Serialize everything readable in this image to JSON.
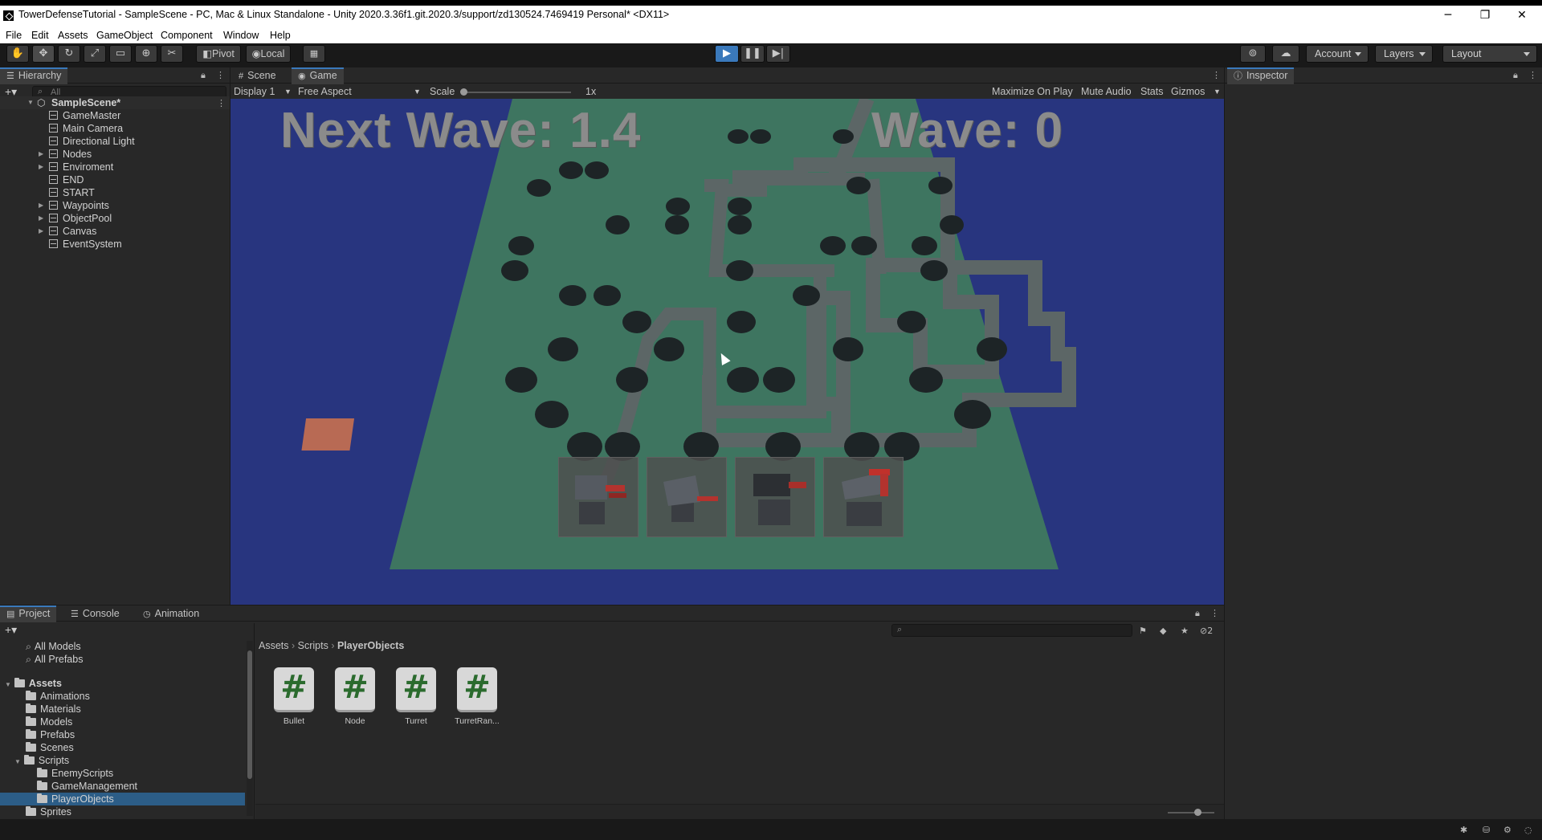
{
  "window": {
    "title": "TowerDefenseTutorial - SampleScene - PC, Mac & Linux Standalone - Unity 2020.3.36f1.git.2020.3/support/zd130524.7469419 Personal* <DX11>",
    "minimize": "─",
    "restore": "❐",
    "close": "✕"
  },
  "menu": [
    "File",
    "Edit",
    "Assets",
    "GameObject",
    "Component",
    "Window",
    "Help"
  ],
  "toolbar": {
    "pivot_label": "Pivot",
    "local_label": "Local",
    "account_label": "Account",
    "layers_label": "Layers",
    "layout_label": "Layout"
  },
  "hierarchy": {
    "tab_label": "Hierarchy",
    "search_placeholder": "All",
    "scene_name": "SampleScene*",
    "items": [
      "GameMaster",
      "Main Camera",
      "Directional Light",
      "Nodes",
      "Enviroment",
      "END",
      "START",
      "Waypoints",
      "ObjectPool",
      "Canvas",
      "EventSystem"
    ]
  },
  "scene_tabs": {
    "scene_label": "Scene",
    "game_label": "Game"
  },
  "game_bar": {
    "display_label": "Display 1",
    "aspect_label": "Free Aspect",
    "scale_label": "Scale",
    "scale_value": "1x",
    "maximize_label": "Maximize On Play",
    "mute_label": "Mute Audio",
    "stats_label": "Stats",
    "gizmos_label": "Gizmos"
  },
  "game_hud": {
    "next_wave": "Next Wave: 1.4",
    "wave": "Wave: 0",
    "turret_slots": 4
  },
  "inspector": {
    "tab_label": "Inspector"
  },
  "project": {
    "tabs": [
      "Project",
      "Console",
      "Animation"
    ],
    "favorites": [
      "All Models",
      "All Prefabs"
    ],
    "assets_root": "Assets",
    "folders": [
      "Animations",
      "Materials",
      "Models",
      "Prefabs",
      "Scenes"
    ],
    "scripts_folder": "Scripts",
    "script_subfolders": [
      "EnemyScripts",
      "GameManagement",
      "PlayerObjects"
    ],
    "after_folders": [
      "Sprites"
    ],
    "breadcrumb": [
      "Assets",
      "Scripts",
      "PlayerObjects"
    ],
    "hidden_count": "2",
    "files": [
      "Bullet",
      "Node",
      "Turret",
      "TurretRan..."
    ]
  },
  "colors": {
    "accent": "#3a79bb",
    "sky": "#28357f",
    "ground": "#3e7560",
    "path": "#5c6666",
    "rock": "#1d2426",
    "end_tile": "#b86a54"
  }
}
